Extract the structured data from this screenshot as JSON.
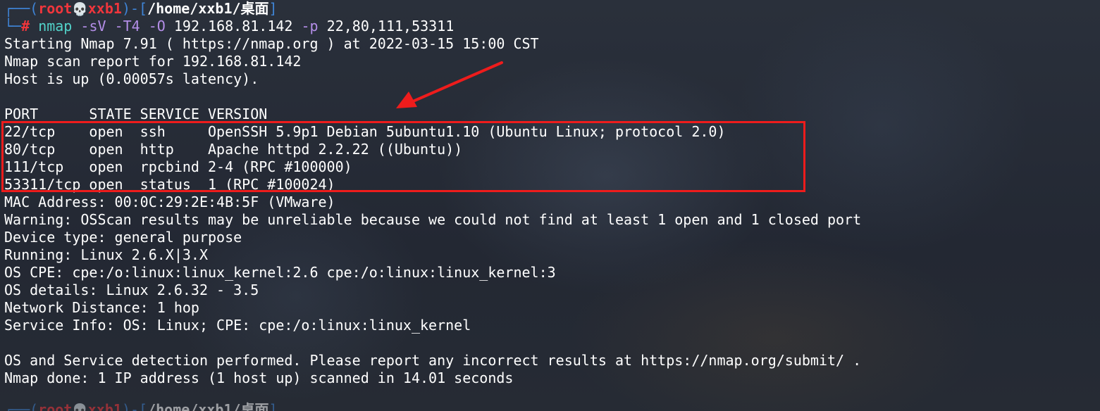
{
  "prompt": {
    "user": "root",
    "host": "xxb1",
    "path": "/home/xxb1/桌面",
    "symbol": "#",
    "skull": "💀"
  },
  "command": {
    "program": "nmap",
    "flag_sv": "-sV",
    "flag_t4": "-T4",
    "flag_o": "-O",
    "target": "192.168.81.142",
    "flag_p": "-p",
    "ports": "22,80,111,53311"
  },
  "output": {
    "lines": [
      "Starting Nmap 7.91 ( https://nmap.org ) at 2022-03-15 15:00 CST",
      "Nmap scan report for 192.168.81.142",
      "Host is up (0.00057s latency).",
      "",
      "PORT      STATE SERVICE VERSION",
      "22/tcp    open  ssh     OpenSSH 5.9p1 Debian 5ubuntu1.10 (Ubuntu Linux; protocol 2.0)",
      "80/tcp    open  http    Apache httpd 2.2.22 ((Ubuntu))",
      "111/tcp   open  rpcbind 2-4 (RPC #100000)",
      "53311/tcp open  status  1 (RPC #100024)",
      "MAC Address: 00:0C:29:2E:4B:5F (VMware)",
      "Warning: OSScan results may be unreliable because we could not find at least 1 open and 1 closed port",
      "Device type: general purpose",
      "Running: Linux 2.6.X|3.X",
      "OS CPE: cpe:/o:linux:linux_kernel:2.6 cpe:/o:linux:linux_kernel:3",
      "OS details: Linux 2.6.32 - 3.5",
      "Network Distance: 1 hop",
      "Service Info: OS: Linux; CPE: cpe:/o:linux:linux_kernel",
      "",
      "OS and Service detection performed. Please report any incorrect results at https://nmap.org/submit/ .",
      "Nmap done: 1 IP address (1 host up) scanned in 14.01 seconds"
    ]
  },
  "colors": {
    "prompt_frame": "#3f84d6",
    "prompt_user": "#f0363c",
    "command": "#52d2c9",
    "option": "#b48ee8",
    "annotation": "#ee1c1c",
    "background": "#252b36"
  },
  "annotations": {
    "box_target": "port table rows",
    "arrow_target": "port table"
  }
}
